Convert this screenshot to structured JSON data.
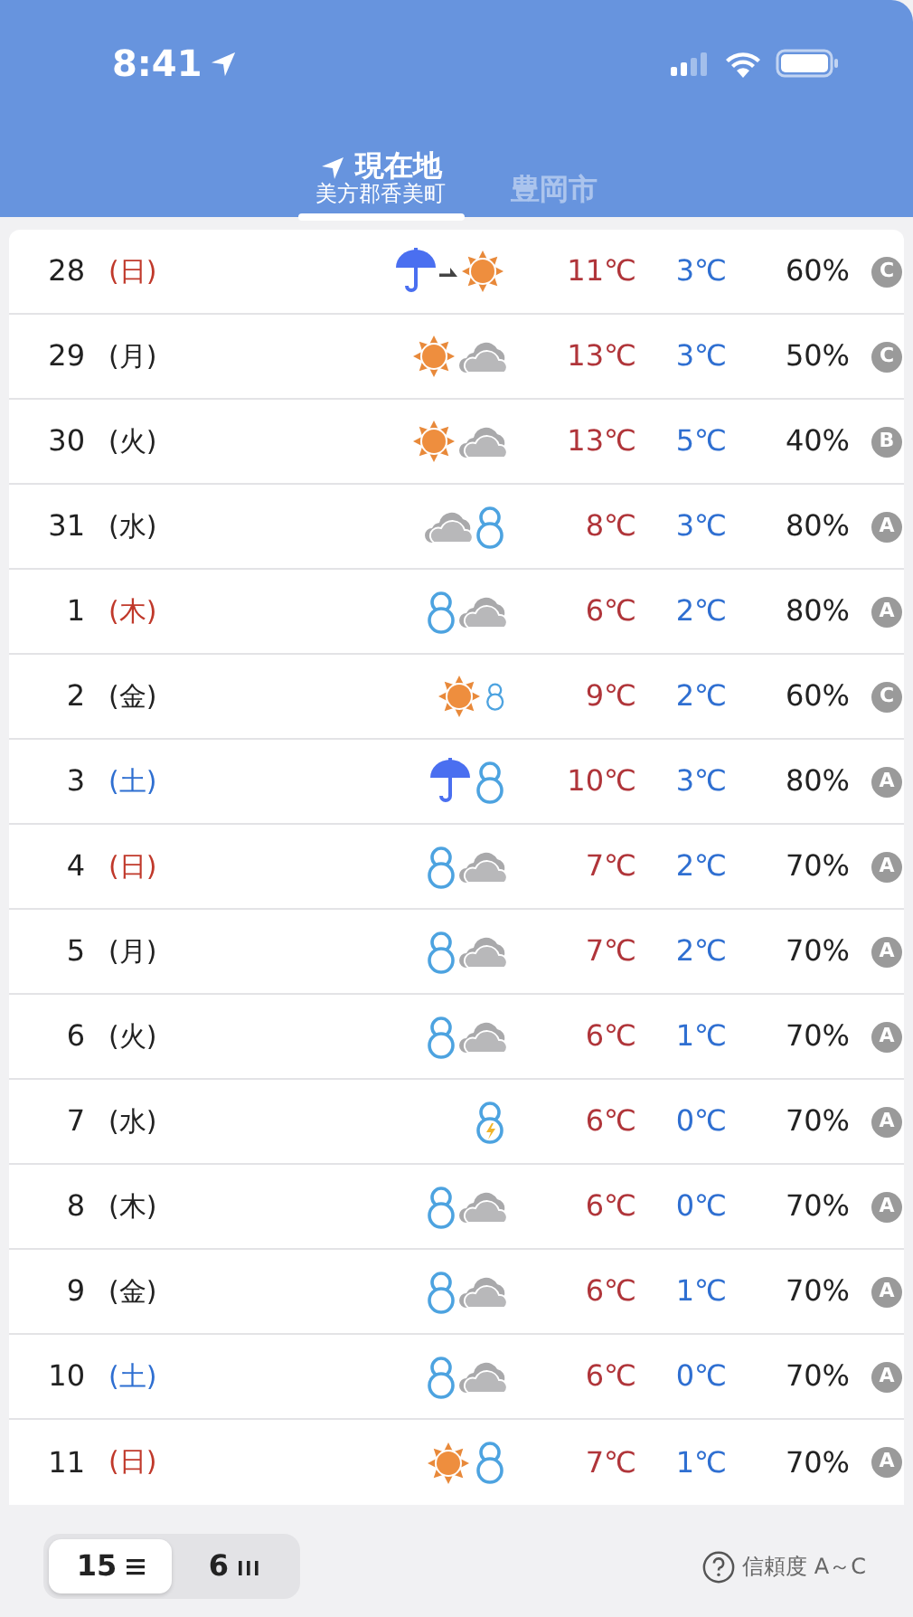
{
  "status_bar": {
    "time": "8:41"
  },
  "tabs": [
    {
      "label": "現在地",
      "sublabel": "美方郡香美町",
      "location": true,
      "selected": true
    },
    {
      "label": "豊岡市",
      "selected": false
    }
  ],
  "days": [
    {
      "day": "28",
      "weekday": "(日)",
      "color": "#c0392b",
      "weather": [
        {
          "kind": "rain"
        },
        {
          "kind": "later"
        },
        {
          "kind": "sun"
        }
      ],
      "high": "11℃",
      "low": "3℃",
      "precip": "60%",
      "reliability": "C"
    },
    {
      "day": "29",
      "weekday": "(月)",
      "color": "#222222",
      "weather": [
        {
          "kind": "sun"
        },
        {
          "kind": "cloud"
        }
      ],
      "high": "13℃",
      "low": "3℃",
      "precip": "50%",
      "reliability": "C"
    },
    {
      "day": "30",
      "weekday": "(火)",
      "color": "#222222",
      "weather": [
        {
          "kind": "sun"
        },
        {
          "kind": "cloud"
        }
      ],
      "high": "13℃",
      "low": "5℃",
      "precip": "40%",
      "reliability": "B"
    },
    {
      "day": "31",
      "weekday": "(水)",
      "color": "#222222",
      "weather": [
        {
          "kind": "cloud"
        },
        {
          "kind": "snow"
        }
      ],
      "high": "8℃",
      "low": "3℃",
      "precip": "80%",
      "reliability": "A"
    },
    {
      "day": "1",
      "weekday": "(木)",
      "color": "#c0392b",
      "weather": [
        {
          "kind": "snow"
        },
        {
          "kind": "cloud"
        }
      ],
      "high": "6℃",
      "low": "2℃",
      "precip": "80%",
      "reliability": "A"
    },
    {
      "day": "2",
      "weekday": "(金)",
      "color": "#222222",
      "weather": [
        {
          "kind": "sun"
        },
        {
          "kind": "snow-small"
        }
      ],
      "high": "9℃",
      "low": "2℃",
      "precip": "60%",
      "reliability": "C"
    },
    {
      "day": "3",
      "weekday": "(土)",
      "color": "#2f6fd1",
      "weather": [
        {
          "kind": "rain"
        },
        {
          "kind": "snow"
        }
      ],
      "high": "10℃",
      "low": "3℃",
      "precip": "80%",
      "reliability": "A"
    },
    {
      "day": "4",
      "weekday": "(日)",
      "color": "#c0392b",
      "weather": [
        {
          "kind": "snow"
        },
        {
          "kind": "cloud"
        }
      ],
      "high": "7℃",
      "low": "2℃",
      "precip": "70%",
      "reliability": "A"
    },
    {
      "day": "5",
      "weekday": "(月)",
      "color": "#222222",
      "weather": [
        {
          "kind": "snow"
        },
        {
          "kind": "cloud"
        }
      ],
      "high": "7℃",
      "low": "2℃",
      "precip": "70%",
      "reliability": "A"
    },
    {
      "day": "6",
      "weekday": "(火)",
      "color": "#222222",
      "weather": [
        {
          "kind": "snow"
        },
        {
          "kind": "cloud"
        }
      ],
      "high": "6℃",
      "low": "1℃",
      "precip": "70%",
      "reliability": "A"
    },
    {
      "day": "7",
      "weekday": "(水)",
      "color": "#222222",
      "weather": [
        {
          "kind": "snow-thunder"
        }
      ],
      "high": "6℃",
      "low": "0℃",
      "precip": "70%",
      "reliability": "A"
    },
    {
      "day": "8",
      "weekday": "(木)",
      "color": "#222222",
      "weather": [
        {
          "kind": "snow"
        },
        {
          "kind": "cloud"
        }
      ],
      "high": "6℃",
      "low": "0℃",
      "precip": "70%",
      "reliability": "A"
    },
    {
      "day": "9",
      "weekday": "(金)",
      "color": "#222222",
      "weather": [
        {
          "kind": "snow"
        },
        {
          "kind": "cloud"
        }
      ],
      "high": "6℃",
      "low": "1℃",
      "precip": "70%",
      "reliability": "A"
    },
    {
      "day": "10",
      "weekday": "(土)",
      "color": "#2f6fd1",
      "weather": [
        {
          "kind": "snow"
        },
        {
          "kind": "cloud"
        }
      ],
      "high": "6℃",
      "low": "0℃",
      "precip": "70%",
      "reliability": "A"
    },
    {
      "day": "11",
      "weekday": "(日)",
      "color": "#c0392b",
      "weather": [
        {
          "kind": "sun"
        },
        {
          "kind": "snow"
        }
      ],
      "high": "7℃",
      "low": "1℃",
      "precip": "70%",
      "reliability": "A"
    }
  ],
  "footer": {
    "segments": [
      {
        "label": "15",
        "kind": "list",
        "selected": true
      },
      {
        "label": "6",
        "kind": "bars",
        "selected": false
      }
    ],
    "help": "信頼度 A～C"
  }
}
